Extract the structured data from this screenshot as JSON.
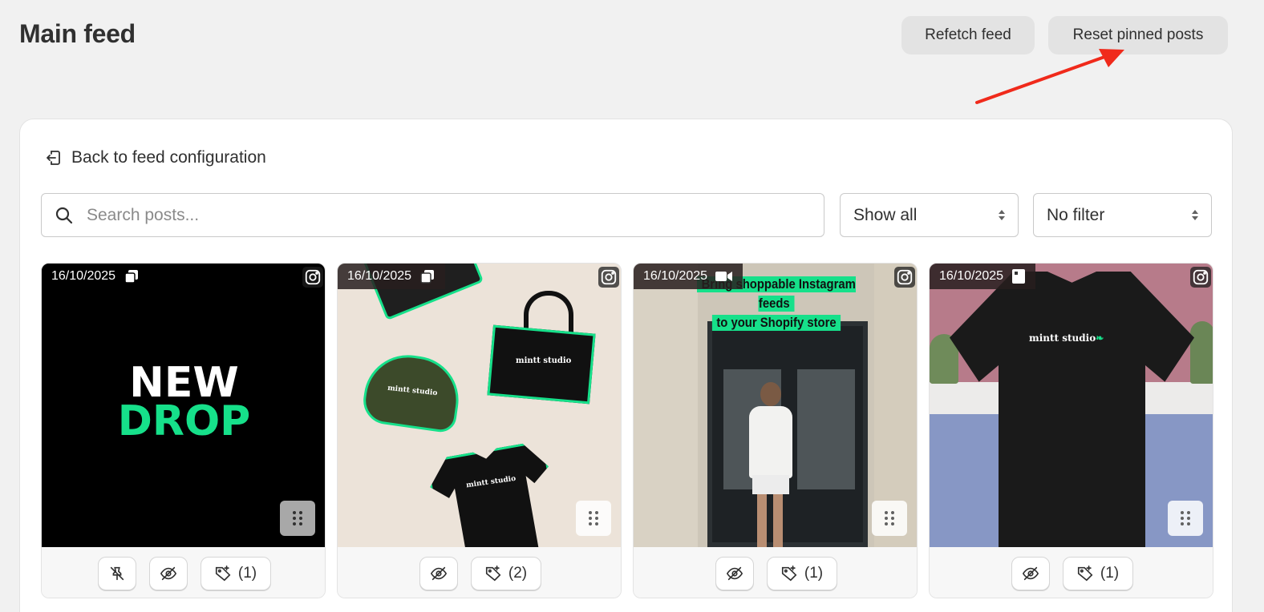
{
  "page": {
    "title": "Main feed"
  },
  "header": {
    "refetch_label": "Refetch feed",
    "reset_label": "Reset pinned posts"
  },
  "colors": {
    "accent_arrow": "#f02a1b",
    "brand_green": "#16e08a",
    "bg": "#f1f1f1"
  },
  "config": {
    "back_label": "Back to feed configuration"
  },
  "search": {
    "placeholder": "Search posts...",
    "value": ""
  },
  "filters": {
    "show_value": "Show all",
    "filter_value": "No filter"
  },
  "posts": [
    {
      "date": "16/10/2025",
      "type_icon": "carousel-icon",
      "headline_1": "NEW",
      "headline_2": "DROP",
      "pinned": true,
      "tag_count": "(1)"
    },
    {
      "date": "16/10/2025",
      "type_icon": "carousel-icon",
      "brand": "mintt studio",
      "pinned": false,
      "tag_count": "(2)"
    },
    {
      "date": "16/10/2025",
      "type_icon": "video-icon",
      "caption_line_1": "Bring shoppable Instagram feeds",
      "caption_line_2": "to your Shopify store",
      "pinned": false,
      "tag_count": "(1)"
    },
    {
      "date": "16/10/2025",
      "type_icon": "image-icon",
      "brand": "mintt studio",
      "pinned": false,
      "tag_count": "(1)"
    }
  ]
}
